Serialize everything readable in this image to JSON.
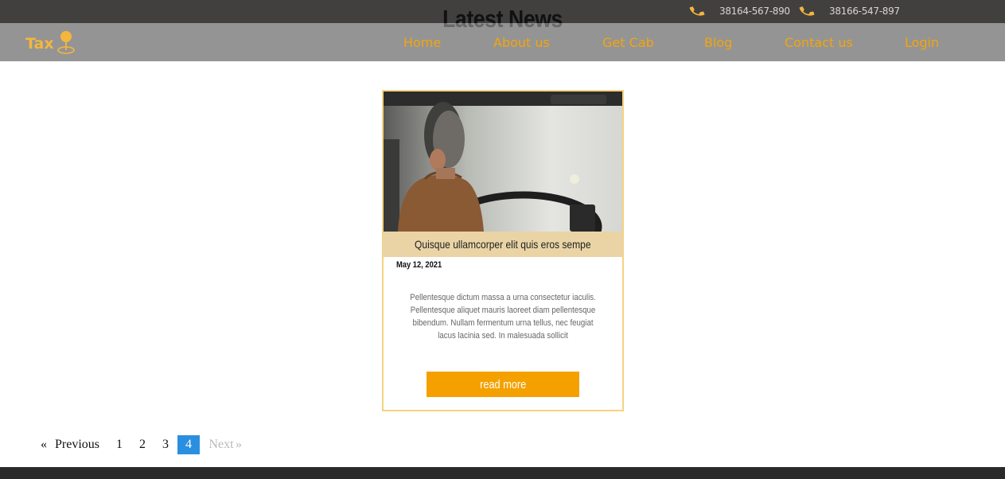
{
  "colors": {
    "topbar_bg": "#423f3f",
    "nav_link": "#f3a50c",
    "logo": "#f5b63d",
    "accent_button": "#f4a100",
    "card_border": "#f6d27f",
    "card_title_bg": "#ead4a6",
    "pagination_active": "#2b8fe0",
    "footer_bg": "#2b2a2a"
  },
  "topbar": {
    "phones": [
      {
        "icon": "phone-icon",
        "number": "38164-567-890"
      },
      {
        "icon": "phone-icon",
        "number": "38166-547-897"
      }
    ]
  },
  "section": {
    "title": "Latest News"
  },
  "navbar": {
    "logo_text": "Tax",
    "logo_icon": "map-pin-icon",
    "links": [
      "Home",
      "About us",
      "Get Cab",
      "Blog",
      "Contact us",
      "Login"
    ]
  },
  "card": {
    "image_icon": "taxi-driver-photo",
    "title": "Quisque ullamcorper elit quis eros sempe",
    "date": "May 12, 2021",
    "text": "Pellentesque dictum massa a urna consectetur iaculis. Pellentesque aliquet mauris laoreet diam pellentesque bibendum. Nullam fermentum urna tellus, nec feugiat lacus lacinia sed. In malesuada sollicit",
    "button": "read more"
  },
  "pagination": {
    "prev_arrow": "«",
    "prev": "Previous",
    "pages": [
      "1",
      "2",
      "3",
      "4"
    ],
    "current": "4",
    "next": "Next",
    "next_arrow": "»"
  }
}
